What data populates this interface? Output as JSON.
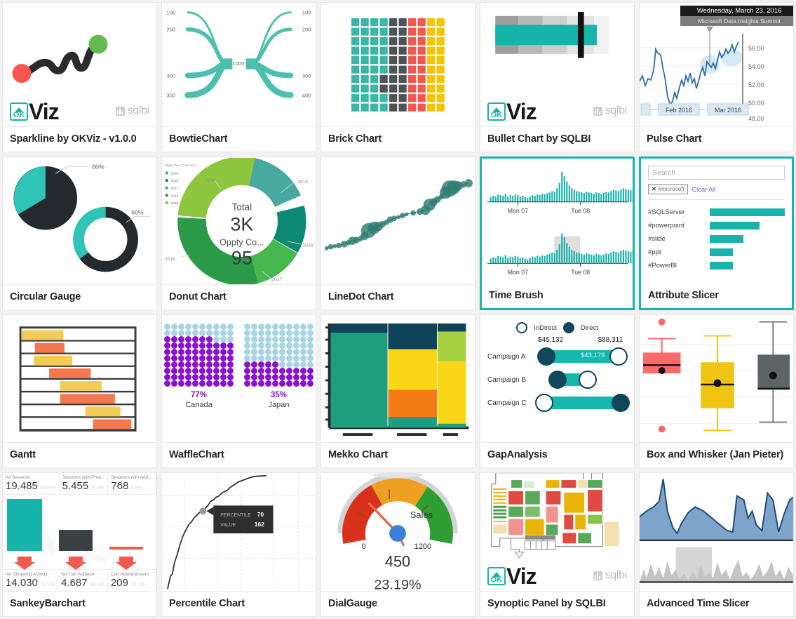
{
  "gallery": {
    "columns": 5,
    "rows": 4,
    "accent_color": "#16b4ab",
    "background": "#f2f2f2",
    "cards": [
      {
        "id": "sparkline-okviz",
        "title": "Sparkline by OKViz - v1.0.0",
        "selected": false,
        "branding": [
          "okviz-logo",
          "sqlbi-logo"
        ],
        "okviz_text": {
          "ok": "OK",
          "viz": "Viz"
        },
        "sqlbi_text": "sqlbi"
      },
      {
        "id": "bowtie-chart",
        "title": "BowtieChart",
        "selected": false,
        "center_value": "1000",
        "left_labels": [
          "100",
          "250",
          "300",
          "350"
        ],
        "right_labels": [
          "100",
          "200",
          "300",
          "400"
        ]
      },
      {
        "id": "brick-chart",
        "title": "Brick Chart",
        "selected": false,
        "grid": "10x10 bricks",
        "colors": [
          "#3cb6a4",
          "#4e5356",
          "#f4554f",
          "#f5c400"
        ]
      },
      {
        "id": "bullet-chart-sqlbi",
        "title": "Bullet Chart by SQLBI",
        "selected": false,
        "branding": [
          "okviz-logo",
          "sqlbi-logo"
        ],
        "okviz_text": {
          "ok": "OK",
          "viz": "Viz"
        },
        "sqlbi_text": "sqlbi"
      },
      {
        "id": "pulse-chart",
        "title": "Pulse Chart",
        "selected": false,
        "tooltip_date": "Wednesday, March 23, 2016",
        "tooltip_event": "Microsoft Data Insights Summit",
        "y_ticks": [
          "56.00",
          "54.00",
          "52.00",
          "50.00",
          "48.00"
        ],
        "x_ticks": [
          "Feb 2016",
          "Mar 2016"
        ]
      },
      {
        "id": "circular-gauge",
        "title": "Circular Gauge",
        "selected": false,
        "pie_label": "60%",
        "donut_label": "60%",
        "colors": [
          "#2ec4b6",
          "#23292c"
        ]
      },
      {
        "id": "donut-chart",
        "title": "Donut Chart",
        "selected": false,
        "legend_title": "Oppty Rev CO by Year",
        "legend_items": [
          "2015",
          "2016",
          "2017",
          "2018",
          "2019"
        ],
        "center_label_1": "Total",
        "center_value_1": "3K",
        "center_label_2": "Oppty Co...",
        "center_value_2": "95",
        "callouts": [
          "2015",
          "2016",
          "2017",
          "2018",
          "2019"
        ]
      },
      {
        "id": "linedot-chart",
        "title": "LineDot Chart",
        "selected": false,
        "color": "#2e7d72"
      },
      {
        "id": "time-brush",
        "title": "Time Brush",
        "selected": true,
        "top_axis": [
          "Mon 07",
          "Tue 08"
        ],
        "bottom_axis": [
          "Mon 07",
          "Tue 08"
        ],
        "color": "#16b4ab"
      },
      {
        "id": "attribute-slicer",
        "title": "Attribute Slicer",
        "selected": true,
        "search_placeholder": "Search",
        "active_tag": "#microsoft",
        "tag_remove": "✕",
        "clear_all": "Clear All",
        "items": [
          {
            "label": "#SQLServer",
            "bar_pct": 100
          },
          {
            "label": "#powerpoint",
            "bar_pct": 66
          },
          {
            "label": "#slide",
            "bar_pct": 45
          },
          {
            "label": "#ppt",
            "bar_pct": 31
          },
          {
            "label": "#PowerBI",
            "bar_pct": 31
          }
        ]
      },
      {
        "id": "gantt",
        "title": "Gantt",
        "selected": false,
        "rows": 8,
        "colors": [
          "#f2cd55",
          "#f3774f"
        ]
      },
      {
        "id": "waffle-chart",
        "title": "WaffleChart",
        "selected": false,
        "items": [
          {
            "pct": "77%",
            "name": "Canada",
            "filled": 77
          },
          {
            "pct": "35%",
            "name": "Japan",
            "filled": 35
          }
        ],
        "fill_color": "#8b11d0",
        "empty_color": "#a8d5e5"
      },
      {
        "id": "mekko-chart",
        "title": "Mekko Chart",
        "selected": false,
        "colors": [
          "#0f4458",
          "#f9d616",
          "#f47b16",
          "#1f9e7e",
          "#a8d141"
        ]
      },
      {
        "id": "gap-analysis",
        "title": "GapAnalysis",
        "selected": false,
        "legend": [
          {
            "label": "InDirect",
            "style": "open"
          },
          {
            "label": "Direct",
            "style": "filled"
          }
        ],
        "scale_min": "$45,132",
        "scale_max": "$88,311",
        "gap_value": "$43,179",
        "campaigns": [
          {
            "name": "Campaign A",
            "left": "filled",
            "right": "open",
            "start": 2,
            "width": 96,
            "label": "$43,179"
          },
          {
            "name": "Campaign B",
            "left": "filled",
            "right": "open",
            "start": 15,
            "width": 48,
            "label": ""
          },
          {
            "name": "Campaign C",
            "left": "open",
            "right": "filled",
            "start": 0,
            "width": 100,
            "label": ""
          }
        ]
      },
      {
        "id": "box-whisker",
        "title": "Box and Whisker (Jan Pieter)",
        "selected": false,
        "boxes": [
          {
            "color": "#f96b6b",
            "outliers": 2
          },
          {
            "color": "#f0c413",
            "outliers": 0
          },
          {
            "color": "#5d6466",
            "outliers": 0
          }
        ]
      },
      {
        "id": "sankey-barchart",
        "title": "SankeyBarchart",
        "selected": false,
        "top_metrics": [
          {
            "label": "All Sessions",
            "value": "19.485",
            "pct": "100.0%"
          },
          {
            "label": "Sessions with Prod...",
            "value": "5.455",
            "pct": "28.0%"
          },
          {
            "label": "Sessions with Add...",
            "value": "768",
            "pct": "3.9%"
          }
        ],
        "bottom_metrics": [
          {
            "label": "No Shopping Activity",
            "value": "14.030",
            "pct": "-72.0%"
          },
          {
            "label": "No Cart Addition",
            "value": "4.687",
            "pct": "-85.9%"
          },
          {
            "label": "Cart Abandonment",
            "value": "209",
            "pct": "-27.2%"
          }
        ]
      },
      {
        "id": "percentile-chart",
        "title": "Percentile Chart",
        "selected": false,
        "tooltip": [
          {
            "key": "PERCENTILE",
            "value": "70"
          },
          {
            "key": "VALUE",
            "value": "162"
          }
        ]
      },
      {
        "id": "dial-gauge",
        "title": "DialGauge",
        "selected": false,
        "measure_label": "Sales",
        "min": "0",
        "max": "1200",
        "value": "450",
        "percent": "23.19%",
        "band_colors": [
          "#d8301a",
          "#f0a020",
          "#2e9e32"
        ]
      },
      {
        "id": "synoptic-panel-sqlbi",
        "title": "Synoptic Panel by SQLBI",
        "selected": false,
        "branding": [
          "okviz-logo",
          "sqlbi-logo"
        ],
        "okviz_text": {
          "ok": "OK",
          "viz": "Viz"
        },
        "sqlbi_text": "sqlbi"
      },
      {
        "id": "advanced-time-slicer",
        "title": "Advanced Time Slicer",
        "selected": false,
        "top_color": "#6f9bc4",
        "bottom_color": "#cccccc"
      }
    ]
  }
}
